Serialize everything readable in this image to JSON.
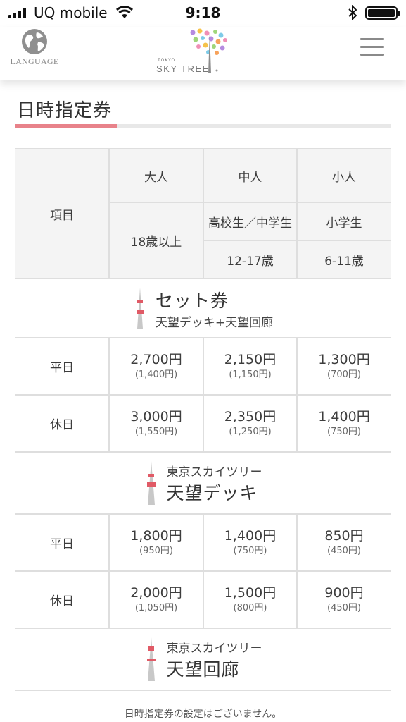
{
  "status_bar": {
    "carrier": "UQ mobile",
    "time": "9:18"
  },
  "header": {
    "language_label": "LANGUAGE",
    "logo_small": "TOKYO",
    "logo_text": "SKY TREE",
    "colors": {
      "accent": "#e8828a",
      "logo_dots": [
        "#f6c24b",
        "#f08fb6",
        "#9fd67a",
        "#b58be0",
        "#7ecbe8",
        "#f7a25a"
      ]
    }
  },
  "page": {
    "title": "日時指定券",
    "footnote": "日時指定券の設定はございません。"
  },
  "table": {
    "header": {
      "item_label": "項目",
      "adult": "大人",
      "middle": "中人",
      "child": "小人",
      "adult_age": "18歳以上",
      "middle_grade": "高校生／中学生",
      "child_grade": "小学生",
      "middle_age": "12-17歳",
      "child_age": "6-11歳"
    },
    "sections": [
      {
        "title": "セット券",
        "subtitle": "天望デッキ+天望回廊",
        "rows": [
          {
            "label": "平日",
            "adult": "2,700円",
            "adult_sub": "(1,400円)",
            "middle": "2,150円",
            "middle_sub": "(1,150円)",
            "child": "1,300円",
            "child_sub": "(700円)"
          },
          {
            "label": "休日",
            "adult": "3,000円",
            "adult_sub": "(1,550円)",
            "middle": "2,350円",
            "middle_sub": "(1,250円)",
            "child": "1,400円",
            "child_sub": "(750円)"
          }
        ]
      },
      {
        "overline": "東京スカイツリー",
        "title": "天望デッキ",
        "rows": [
          {
            "label": "平日",
            "adult": "1,800円",
            "adult_sub": "(950円)",
            "middle": "1,400円",
            "middle_sub": "(750円)",
            "child": "850円",
            "child_sub": "(450円)"
          },
          {
            "label": "休日",
            "adult": "2,000円",
            "adult_sub": "(1,050円)",
            "middle": "1,500円",
            "middle_sub": "(800円)",
            "child": "900円",
            "child_sub": "(450円)"
          }
        ]
      },
      {
        "overline": "東京スカイツリー",
        "title": "天望回廊"
      }
    ]
  }
}
